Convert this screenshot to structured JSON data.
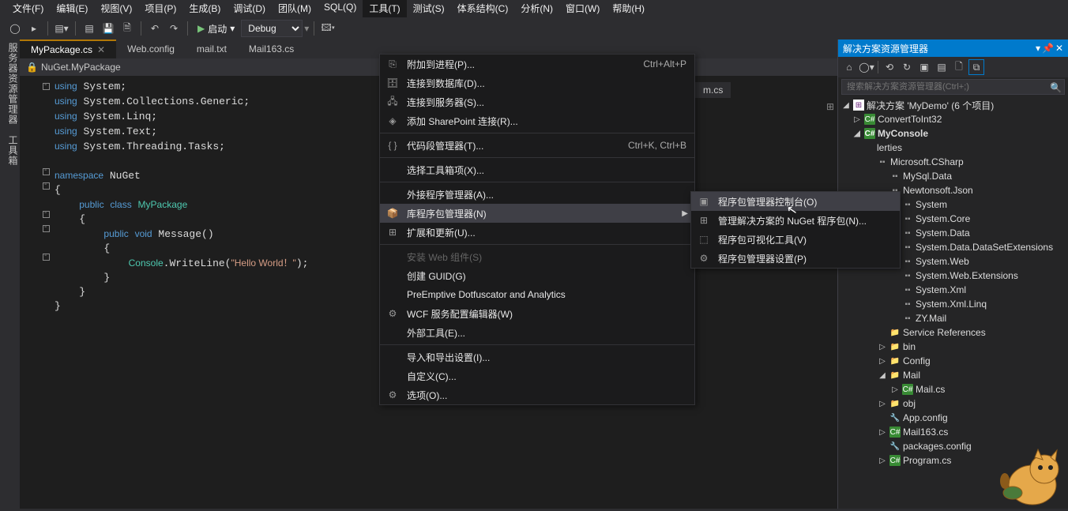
{
  "menubar": {
    "items": [
      "文件(F)",
      "编辑(E)",
      "视图(V)",
      "项目(P)",
      "生成(B)",
      "调试(D)",
      "团队(M)",
      "SQL(Q)",
      "工具(T)",
      "测试(S)",
      "体系结构(C)",
      "分析(N)",
      "窗口(W)",
      "帮助(H)"
    ],
    "active_index": 8
  },
  "toolbar": {
    "start_label": "启动",
    "config": "Debug"
  },
  "tabs": {
    "items": [
      "MyPackage.cs",
      "Web.config",
      "mail.txt",
      "Mail163.cs"
    ],
    "active_index": 0,
    "extra": "m.cs"
  },
  "breadcrumb": "NuGet.MyPackage",
  "code_lines": [
    {
      "k": "using",
      "t": " System;"
    },
    {
      "k": "using",
      "t": " System.Collections.Generic;"
    },
    {
      "k": "using",
      "t": " System.Linq;"
    },
    {
      "k": "using",
      "t": " System.Text;"
    },
    {
      "k": "using",
      "t": " System.Threading.Tasks;"
    }
  ],
  "code_ns": "NuGet",
  "code_class": "MyPackage",
  "code_method": "Message",
  "code_string": "\"Hello World！\"",
  "tools_menu": {
    "items": [
      {
        "icon": "attach",
        "label": "附加到进程(P)...",
        "shortcut": "Ctrl+Alt+P"
      },
      {
        "icon": "db",
        "label": "连接到数据库(D)..."
      },
      {
        "icon": "server",
        "label": "连接到服务器(S)..."
      },
      {
        "icon": "sp",
        "label": "添加 SharePoint 连接(R)..."
      },
      {
        "sep": true
      },
      {
        "icon": "snippet",
        "label": "代码段管理器(T)...",
        "shortcut": "Ctrl+K, Ctrl+B"
      },
      {
        "sep": true
      },
      {
        "label": "选择工具箱项(X)..."
      },
      {
        "sep": true
      },
      {
        "label": "外接程序管理器(A)..."
      },
      {
        "icon": "pkg",
        "label": "库程序包管理器(N)",
        "arrow": true,
        "hl": true
      },
      {
        "icon": "ext",
        "label": "扩展和更新(U)..."
      },
      {
        "sep": true
      },
      {
        "label": "安装 Web 组件(S)",
        "disabled": true
      },
      {
        "label": "创建 GUID(G)"
      },
      {
        "label": "PreEmptive Dotfuscator and Analytics"
      },
      {
        "icon": "wcf",
        "label": "WCF 服务配置编辑器(W)"
      },
      {
        "label": "外部工具(E)..."
      },
      {
        "sep": true
      },
      {
        "label": "导入和导出设置(I)..."
      },
      {
        "label": "自定义(C)..."
      },
      {
        "icon": "gear",
        "label": "选项(O)..."
      }
    ]
  },
  "sub_menu": {
    "items": [
      {
        "icon": "console",
        "label": "程序包管理器控制台(O)",
        "hl": true
      },
      {
        "icon": "grid",
        "label": "管理解决方案的 NuGet 程序包(N)..."
      },
      {
        "icon": "vis",
        "label": "程序包可视化工具(V)"
      },
      {
        "icon": "gear",
        "label": "程序包管理器设置(P)"
      }
    ]
  },
  "solution_panel": {
    "title": "解决方案资源管理器",
    "search_placeholder": "搜索解决方案资源管理器(Ctrl+;)",
    "root": "解决方案 'MyDemo' (6 个项目)",
    "projects": [
      {
        "exp": "▷",
        "icon": "cs",
        "name": "ConvertToInt32"
      },
      {
        "exp": "◢",
        "icon": "cs",
        "name": "MyConsole",
        "bold": true
      }
    ],
    "subnodes": [
      {
        "indent": 2,
        "label": "lerties",
        "partial": true
      },
      {
        "indent": 2,
        "label": "Microsoft.CSharp",
        "partial": true,
        "icon": "ref"
      },
      {
        "indent": 3,
        "label": "MySql.Data",
        "icon": "ref"
      },
      {
        "indent": 3,
        "label": "Newtonsoft.Json",
        "icon": "ref"
      },
      {
        "indent": 4,
        "label": "System",
        "icon": "ref"
      },
      {
        "indent": 4,
        "label": "System.Core",
        "icon": "ref"
      },
      {
        "indent": 4,
        "label": "System.Data",
        "icon": "ref"
      },
      {
        "indent": 4,
        "label": "System.Data.DataSetExtensions",
        "icon": "ref"
      },
      {
        "indent": 4,
        "label": "System.Web",
        "icon": "ref"
      },
      {
        "indent": 4,
        "label": "System.Web.Extensions",
        "icon": "ref"
      },
      {
        "indent": 4,
        "label": "System.Xml",
        "icon": "ref"
      },
      {
        "indent": 4,
        "label": "System.Xml.Linq",
        "icon": "ref"
      },
      {
        "indent": 4,
        "label": "ZY.Mail",
        "icon": "ref"
      },
      {
        "indent": 3,
        "exp": "",
        "icon": "folder",
        "label": "Service References"
      },
      {
        "indent": 3,
        "exp": "▷",
        "icon": "folder",
        "label": "bin"
      },
      {
        "indent": 3,
        "exp": "▷",
        "icon": "folder",
        "label": "Config"
      },
      {
        "indent": 3,
        "exp": "◢",
        "icon": "folder",
        "label": "Mail"
      },
      {
        "indent": 4,
        "exp": "▷",
        "icon": "cs",
        "label": "Mail.cs"
      },
      {
        "indent": 3,
        "exp": "▷",
        "icon": "folder",
        "label": "obj"
      },
      {
        "indent": 3,
        "icon": "config",
        "label": "App.config"
      },
      {
        "indent": 3,
        "exp": "▷",
        "icon": "cs",
        "label": "Mail163.cs"
      },
      {
        "indent": 3,
        "icon": "config",
        "label": "packages.config"
      },
      {
        "indent": 3,
        "exp": "▷",
        "icon": "cs",
        "label": "Program.cs"
      }
    ]
  },
  "vertical_tabs": [
    "服务器资源管理器",
    "工具箱"
  ]
}
